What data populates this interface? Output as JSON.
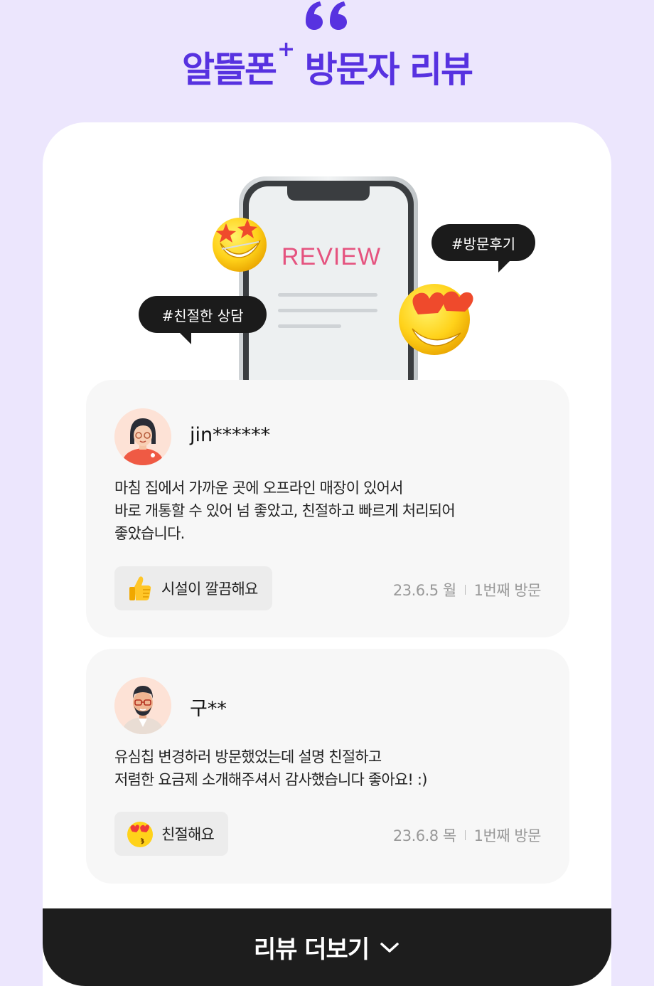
{
  "header": {
    "title_main": "알뜰폰",
    "title_plus": "+",
    "title_rest": "방문자 리뷰"
  },
  "hero": {
    "screen_label": "REVIEW",
    "hashtag_left": "#친절한 상담",
    "hashtag_right": "#방문후기"
  },
  "reviews": [
    {
      "username": "jin******",
      "lines": [
        "마침 집에서 가까운 곳에 오프라인 매장이 있어서",
        "바로 개통할 수 있어 넘 좋았고, 친절하고 빠르게 처리되어",
        "좋았습니다."
      ],
      "tag": "시설이 깔끔해요",
      "tag_icon": "thumbs-up-icon",
      "date": "23.6.5 월",
      "visit": "1번째 방문"
    },
    {
      "username": "구**",
      "lines": [
        "유심칩 변경하러 방문했었는데 설명 친절하고",
        "저렴한 요금제 소개해주셔서 감사했습니다 좋아요! :)"
      ],
      "tag": "친절해요",
      "tag_icon": "kissing-heart-emoji-icon",
      "date": "23.6.8 목",
      "visit": "1번째 방문"
    }
  ],
  "more_button": {
    "label": "리뷰 더보기"
  },
  "colors": {
    "background": "#ece6fd",
    "title": "#5732e0",
    "review_label": "#e5537f",
    "button": "#1d1d1d"
  }
}
